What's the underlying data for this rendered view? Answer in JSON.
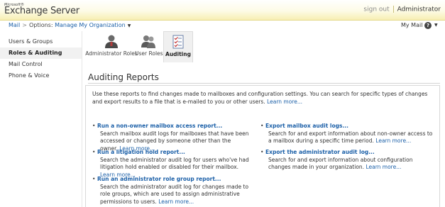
{
  "header": {
    "logo_ms": "Microsoft®",
    "logo_product": "Exchange Server",
    "sign_out": "sign out",
    "user": "Administrator"
  },
  "breadcrumb": {
    "root": "Mail",
    "gt": ">",
    "options_label": "Options:",
    "options_value": "Manage My Organization"
  },
  "top_right": {
    "my_mail": "My Mail",
    "help": "?"
  },
  "sidebar": {
    "items": [
      {
        "label": "Users & Groups",
        "active": false
      },
      {
        "label": "Roles & Auditing",
        "active": true
      },
      {
        "label": "Mail Control",
        "active": false
      },
      {
        "label": "Phone & Voice",
        "active": false
      }
    ]
  },
  "tabs": [
    {
      "label": "Administrator Roles",
      "icon": "administrator-roles-icon",
      "active": false
    },
    {
      "label": "User Roles",
      "icon": "user-roles-icon",
      "active": false
    },
    {
      "label": "Auditing",
      "icon": "auditing-checklist-icon",
      "active": true
    }
  ],
  "page": {
    "title": "Auditing Reports",
    "intro": "Use these reports to find changes made to mailboxes and configuration settings. You can search for specific types of changes and export results to a file that is e-mailed to you or other users.",
    "intro_link": "Learn more..."
  },
  "reports": {
    "left": [
      {
        "title": "Run a non-owner mailbox access report...",
        "desc": "Search mailbox audit logs for mailboxes that have been accessed or changed by someone other than the owner.",
        "link": "Learn more..."
      },
      {
        "title": "Run a litigation hold report...",
        "desc": "Search the administrator audit log for users who've had litigation hold enabled or disabled for their mailbox.",
        "link": "Learn more..."
      },
      {
        "title": "Run an administrator role group report...",
        "desc": "Search the administrator audit log for changes made to role groups, which are used to assign administrative permissions to users.",
        "link": "Learn more..."
      }
    ],
    "right": [
      {
        "title": "Export mailbox audit logs...",
        "desc": "Search for and export information about non-owner access to a mailbox during a specific time period.",
        "link": "Learn more..."
      },
      {
        "title": "Export the administrator audit log...",
        "desc": "Search for and export information about configuration changes made in your organization.",
        "link": "Learn more..."
      }
    ]
  },
  "colors": {
    "link": "#1c60a8",
    "header_gold": "#f7efb3",
    "active_bg": "#f1f1f1"
  }
}
